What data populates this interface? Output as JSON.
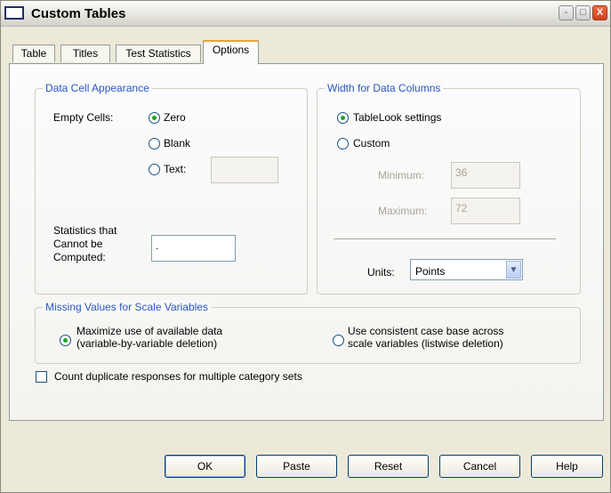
{
  "window": {
    "title": "Custom Tables",
    "controls": [
      "-",
      "□",
      "X"
    ]
  },
  "tabs": [
    {
      "label": "Table"
    },
    {
      "label": "Titles"
    },
    {
      "label": "Test Statistics"
    },
    {
      "label": "Options"
    }
  ],
  "active_tab": "Options",
  "data_cell_appearance": {
    "legend": "Data Cell Appearance",
    "empty_cells_label": "Empty Cells:",
    "options": [
      {
        "label": "Zero",
        "checked": true
      },
      {
        "label": "Blank",
        "checked": false
      },
      {
        "label": "Text:",
        "checked": false
      }
    ],
    "text_value": "",
    "stats_label_lines": [
      "Statistics that",
      "Cannot be",
      "Computed:"
    ],
    "stats_value": "."
  },
  "width_for_data_columns": {
    "legend": "Width for Data Columns",
    "options": [
      {
        "label": "TableLook settings",
        "checked": true
      },
      {
        "label": "Custom",
        "checked": false
      }
    ],
    "minimum_label": "Minimum:",
    "minimum_value": "36",
    "maximum_label": "Maximum:",
    "maximum_value": "72",
    "units_label": "Units:",
    "units_value": "Points"
  },
  "missing_values": {
    "legend": "Missing Values for Scale Variables",
    "options": [
      {
        "lines": [
          "Maximize use of available data",
          "(variable-by-variable deletion)"
        ],
        "checked": true
      },
      {
        "lines": [
          "Use consistent case base across",
          "scale variables (listwise deletion)"
        ],
        "checked": false
      }
    ]
  },
  "count_duplicates": {
    "label": "Count duplicate responses for multiple category sets",
    "checked": false
  },
  "buttons": [
    {
      "label": "OK"
    },
    {
      "label": "Paste"
    },
    {
      "label": "Reset"
    },
    {
      "label": "Cancel"
    },
    {
      "label": "Help"
    }
  ]
}
